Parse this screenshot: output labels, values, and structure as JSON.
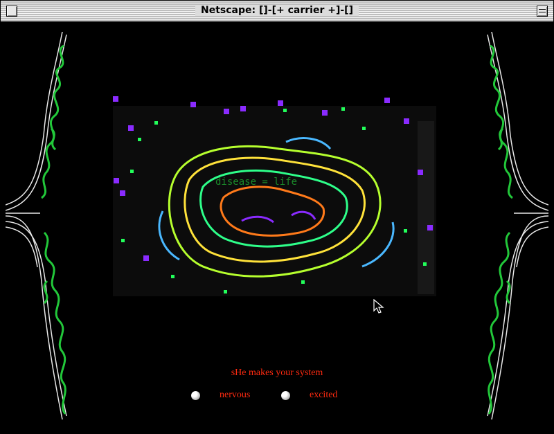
{
  "window": {
    "title": "Netscape: []-[+ carrier +]-[]"
  },
  "artwork": {
    "overlay_text": "disease = life"
  },
  "caption": "sHe makes your system",
  "choices": [
    {
      "label": "nervous",
      "icon": "sphere-bullet-icon"
    },
    {
      "label": "excited",
      "icon": "sphere-bullet-icon"
    }
  ],
  "colors": {
    "background": "#000000",
    "text_accent": "#ff2a10",
    "vine_green": "#22c83a",
    "vine_white": "#e8e8e8",
    "art_yellow": "#e8ff3a",
    "art_purple": "#8a2bff"
  }
}
